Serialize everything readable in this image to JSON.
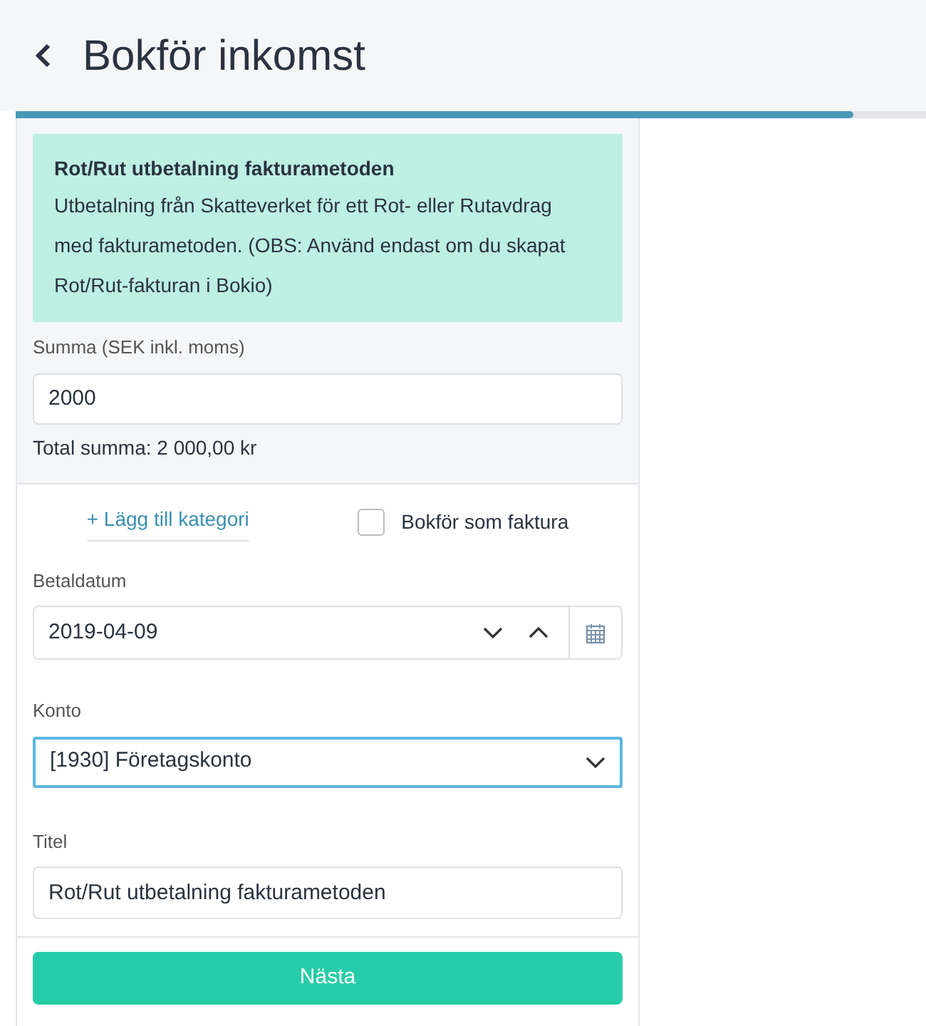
{
  "header": {
    "title": "Bokför inkomst"
  },
  "progress": {
    "level": 0.92
  },
  "info": {
    "title": "Rot/Rut utbetalning fakturametoden",
    "text": "Utbetalning från Skatteverket för ett Rot- eller Rutavdrag med fakturametoden. (OBS: Använd endast om du skapat Rot/Rut-fakturan i Bokio)"
  },
  "amount": {
    "label": "Summa (SEK inkl. moms)",
    "value": "2000",
    "total": "Total summa: 2 000,00 kr"
  },
  "add_category": "+ Lägg till kategori",
  "invoice_checkbox": {
    "label": "Bokför som faktura",
    "checked": false
  },
  "date": {
    "label": "Betaldatum",
    "value": "2019-04-09"
  },
  "account": {
    "label": "Konto",
    "value": "[1930] Företagskonto",
    "focused": true
  },
  "title_field": {
    "label": "Titel",
    "value": "Rot/Rut utbetalning fakturametoden"
  },
  "next_button": "Nästa"
}
